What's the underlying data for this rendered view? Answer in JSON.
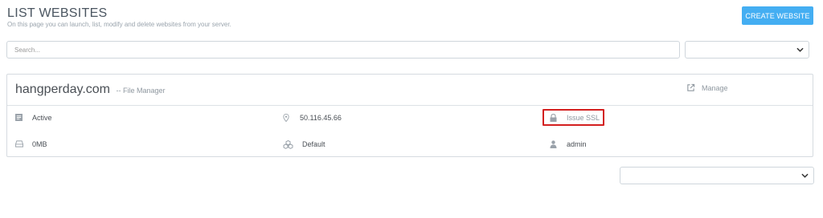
{
  "header": {
    "title": "LIST WEBSITES",
    "subtitle": "On this page you can launch, list, modify and delete websites from your server.",
    "create_button": "CREATE WEBSITE"
  },
  "search": {
    "placeholder": "Search...",
    "filter_value": ""
  },
  "website": {
    "domain": "hangperday.com",
    "file_manager_label": "-- File Manager",
    "manage_label": "Manage",
    "status": "Active",
    "ip": "50.116.45.66",
    "ssl_label": "Issue SSL",
    "disk_usage": "0MB",
    "package": "Default",
    "owner": "admin"
  },
  "pagination": {
    "selected_value": ""
  },
  "colors": {
    "accent": "#44aef2",
    "highlight": "#d31f1f"
  },
  "icons": {
    "manage": "external-link-icon",
    "status": "list-icon",
    "ip": "map-pin-icon",
    "ssl": "lock-icon",
    "disk": "hard-drive-icon",
    "package": "cubes-icon",
    "owner": "user-icon"
  }
}
